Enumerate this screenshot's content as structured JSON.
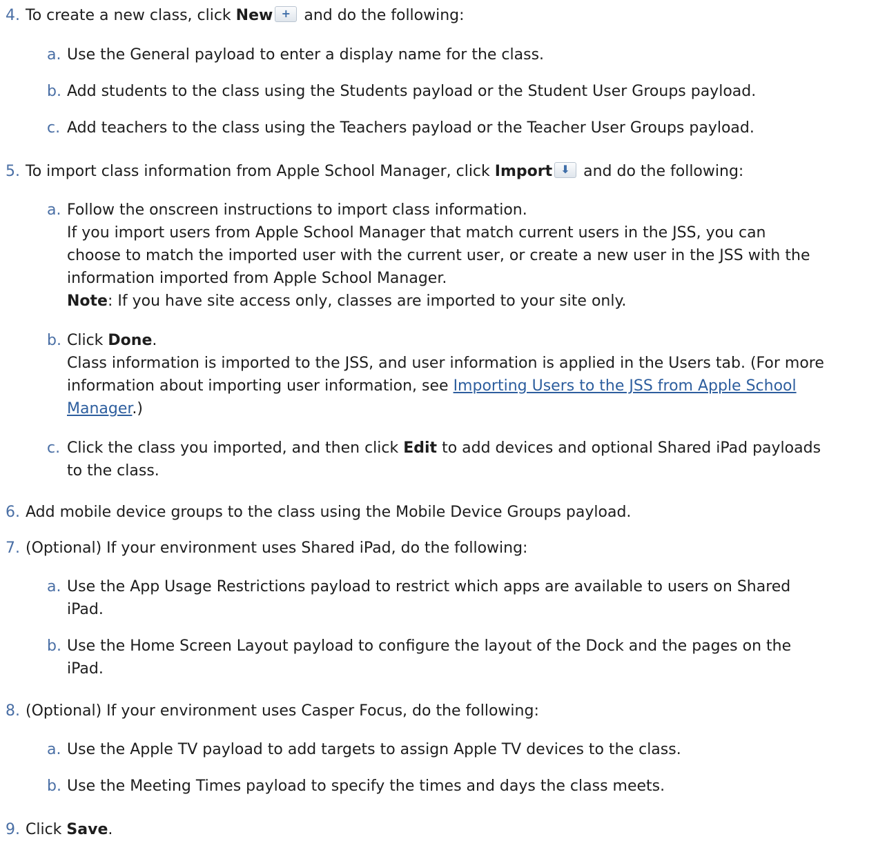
{
  "steps": {
    "s4": {
      "num": "4.",
      "pre": "To create a new class, click ",
      "bold": "New",
      "icon": "plus-icon",
      "post": " and do the following:",
      "subs": {
        "a": {
          "num": "a.",
          "text": "Use the General payload to enter a display name for the class."
        },
        "b": {
          "num": "b.",
          "text": "Add students to the class using the Students payload or the Student User Groups payload."
        },
        "c": {
          "num": "c.",
          "text": "Add teachers to the class using the Teachers payload or the Teacher User Groups payload."
        }
      }
    },
    "s5": {
      "num": "5.",
      "pre": "To import class information from Apple School Manager, click ",
      "bold": "Import",
      "icon": "download-arrow-icon",
      "post": " and do the following:",
      "subs": {
        "a": {
          "num": "a.",
          "line1": "Follow the onscreen instructions to import class information.",
          "line2": "If you import users from Apple School Manager that match current users in the JSS, you can",
          "line3": "choose to match the imported user with the current user, or create a new user in the JSS with the",
          "line4": "information imported from Apple School Manager.",
          "note_bold": "Note",
          "note_text": ": If you have site access only, classes are imported to your site only."
        },
        "b": {
          "num": "b.",
          "pre": "Click ",
          "bold": "Done",
          "post": ".",
          "line2": "Class information is imported to the JSS, and user information is applied in the Users tab. (For more",
          "line3_pre": "information about importing user information, see ",
          "link_part1": "Importing Users to the JSS from Apple School",
          "link_part2": "Manager",
          "line4_post": ".)"
        },
        "c": {
          "num": "c.",
          "pre": "Click the class you imported, and then click ",
          "bold": "Edit",
          "post": " to add devices and optional Shared iPad payloads",
          "line2": "to the class."
        }
      }
    },
    "s6": {
      "num": "6.",
      "text": "Add mobile device groups to the class using the Mobile Device Groups payload."
    },
    "s7": {
      "num": "7.",
      "text": "(Optional) If your environment uses Shared iPad, do the following:",
      "subs": {
        "a": {
          "num": "a.",
          "line1": "Use the App Usage Restrictions payload to restrict which apps are available to users on Shared",
          "line2": "iPad."
        },
        "b": {
          "num": "b.",
          "line1": "Use the Home Screen Layout payload to configure the layout of the Dock and the pages on the",
          "line2": "iPad."
        }
      }
    },
    "s8": {
      "num": "8.",
      "text": "(Optional) If your environment uses Casper Focus, do the following:",
      "subs": {
        "a": {
          "num": "a.",
          "text": "Use the Apple TV payload to add targets to assign Apple TV devices to the class."
        },
        "b": {
          "num": "b.",
          "text": "Use the Meeting Times payload to specify the times and days the class meets."
        }
      }
    },
    "s9": {
      "num": "9.",
      "pre": "Click ",
      "bold": "Save",
      "post": "."
    }
  }
}
